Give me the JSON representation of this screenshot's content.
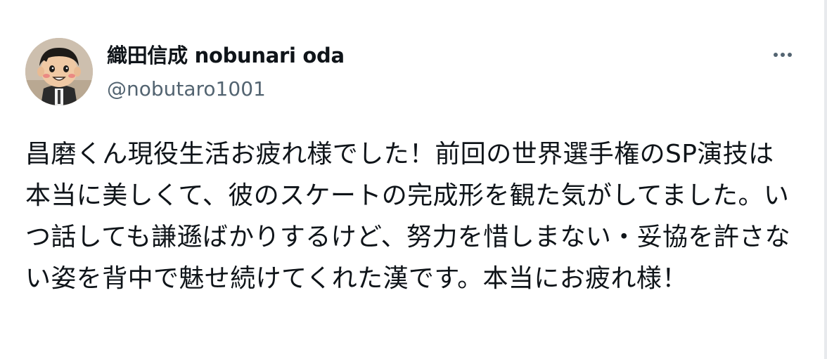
{
  "author": {
    "display_name": "織田信成 nobunari oda",
    "handle": "@nobutaro1001",
    "avatar_icon": "avatar-icon"
  },
  "actions": {
    "more_icon": "more-horizontal-icon"
  },
  "tweet": {
    "text": "昌磨くん現役生活お疲れ様でした！前回の世界選手権のSP演技は本当に美しくて、彼のスケートの完成形を観た気がしてました。いつ話しても謙遜ばかりするけど、努力を惜しまない・妥協を許さない姿を背中で魅せ続けてくれた漢です。本当にお疲れ様！"
  },
  "colors": {
    "text_primary": "#0f1419",
    "text_secondary": "#536471",
    "background": "#ffffff"
  }
}
